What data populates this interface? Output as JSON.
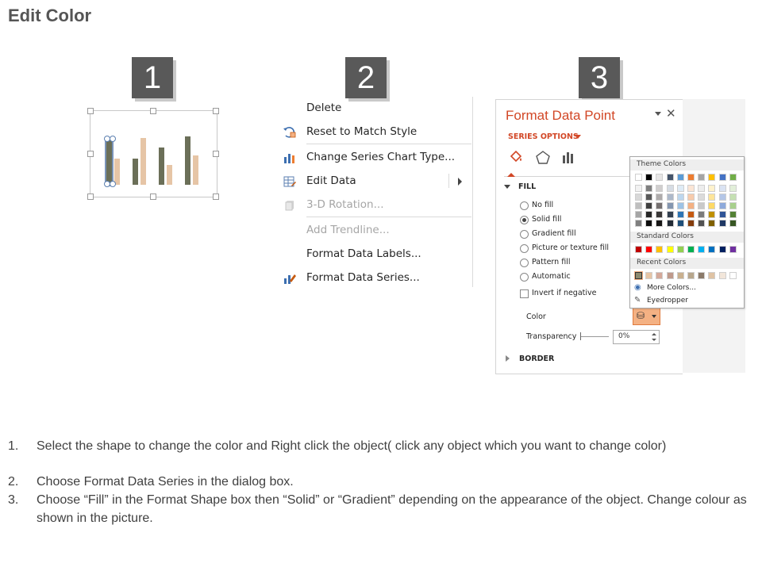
{
  "page": {
    "title": "Edit Color"
  },
  "steps": [
    "1",
    "2",
    "3"
  ],
  "mini_chart": {
    "bar_colors": {
      "dark": "#6b6f58",
      "light": "#e6c5a6",
      "selected_handle": "#7a93b8"
    }
  },
  "context_menu": {
    "items": [
      {
        "label": "Delete",
        "icon": "none",
        "enabled": true
      },
      {
        "label": "Reset to Match Style",
        "icon": "reset-style-icon",
        "enabled": true
      },
      {
        "label": "Change Series Chart Type...",
        "icon": "chart-type-icon",
        "enabled": true
      },
      {
        "label": "Edit Data",
        "icon": "edit-data-icon",
        "enabled": true,
        "submenu": true
      },
      {
        "label": "3-D Rotation...",
        "icon": "rotate-3d-icon",
        "enabled": false
      },
      {
        "label": "Add Trendline...",
        "icon": "none",
        "enabled": false
      },
      {
        "label": "Format Data Labels...",
        "icon": "none",
        "enabled": true
      },
      {
        "label": "Format Data Series...",
        "icon": "format-series-icon",
        "enabled": true
      }
    ]
  },
  "format_pane": {
    "title": "Format Data Point",
    "series_options": "SERIES OPTIONS",
    "tabs": [
      "fill-line-icon",
      "effects-icon",
      "series-options-icon"
    ],
    "fill_section": "FILL",
    "fill_options": [
      {
        "label": "No fill",
        "selected": false
      },
      {
        "label": "Solid fill",
        "selected": true
      },
      {
        "label": "Gradient fill",
        "selected": false
      },
      {
        "label": "Picture or texture fill",
        "selected": false
      },
      {
        "label": "Pattern fill",
        "selected": false
      },
      {
        "label": "Automatic",
        "selected": false
      }
    ],
    "invert_if_negative": "Invert if negative",
    "color_label": "Color",
    "transparency_label": "Transparency",
    "transparency_value": "0%",
    "border_section": "BORDER",
    "accent_color": "#d24726"
  },
  "palette": {
    "theme_header": "Theme Colors",
    "standard_header": "Standard Colors",
    "recent_header": "Recent Colors",
    "theme_top": [
      "#ffffff",
      "#000000",
      "#e7e6e6",
      "#44546a",
      "#5b9bd5",
      "#ed7d31",
      "#a5a5a5",
      "#ffc000",
      "#4472c4",
      "#70ad47"
    ],
    "theme_shades": [
      [
        "#f2f2f2",
        "#7f7f7f",
        "#d0cece",
        "#d6dce4",
        "#deebf6",
        "#fbe5d5",
        "#ededed",
        "#fff2cc",
        "#dae3f3",
        "#e2efd9"
      ],
      [
        "#d8d8d8",
        "#595959",
        "#aeabab",
        "#adb9ca",
        "#bdd7ee",
        "#f7cbac",
        "#dbdbdb",
        "#fee599",
        "#b4c6e7",
        "#c5e0b3"
      ],
      [
        "#bfbfbf",
        "#3f3f3f",
        "#757070",
        "#8496b0",
        "#9dc3e6",
        "#f4b183",
        "#c9c9c9",
        "#ffd965",
        "#8eaadb",
        "#a8d08d"
      ],
      [
        "#a5a5a5",
        "#262626",
        "#3a3838",
        "#323f4f",
        "#2e75b5",
        "#c55a11",
        "#7b7b7b",
        "#bf9000",
        "#2f5496",
        "#538135"
      ],
      [
        "#7f7f7f",
        "#0c0c0c",
        "#171616",
        "#222a35",
        "#1e4e79",
        "#843c0b",
        "#525252",
        "#7f6000",
        "#1f3864",
        "#375623"
      ]
    ],
    "standard": [
      "#c00000",
      "#ff0000",
      "#ffc000",
      "#ffff00",
      "#92d050",
      "#00b050",
      "#00b0f0",
      "#0070c0",
      "#002060",
      "#7030a0"
    ],
    "recent": [
      "#8c8a6f",
      "#e6c5a6",
      "#d4a99a",
      "#bf9a8c",
      "#c9b08f",
      "#b7a68c",
      "#8b7a6a",
      "#dfc3a4",
      "#f2e6da",
      "#ffffff"
    ],
    "more_colors": "More Colors...",
    "eyedropper": "Eyedropper"
  },
  "instructions": [
    {
      "num": "1.",
      "text": "Select the shape to change the color and Right click the object( click any object which you want to change color)"
    },
    {
      "num": "2.",
      "text": "Choose Format Data Series in the dialog box."
    },
    {
      "num": "3.",
      "text": "Choose “Fill” in the Format Shape box then “Solid” or “Gradient” depending on the appearance of the object. Change colour as shown in the picture."
    }
  ]
}
